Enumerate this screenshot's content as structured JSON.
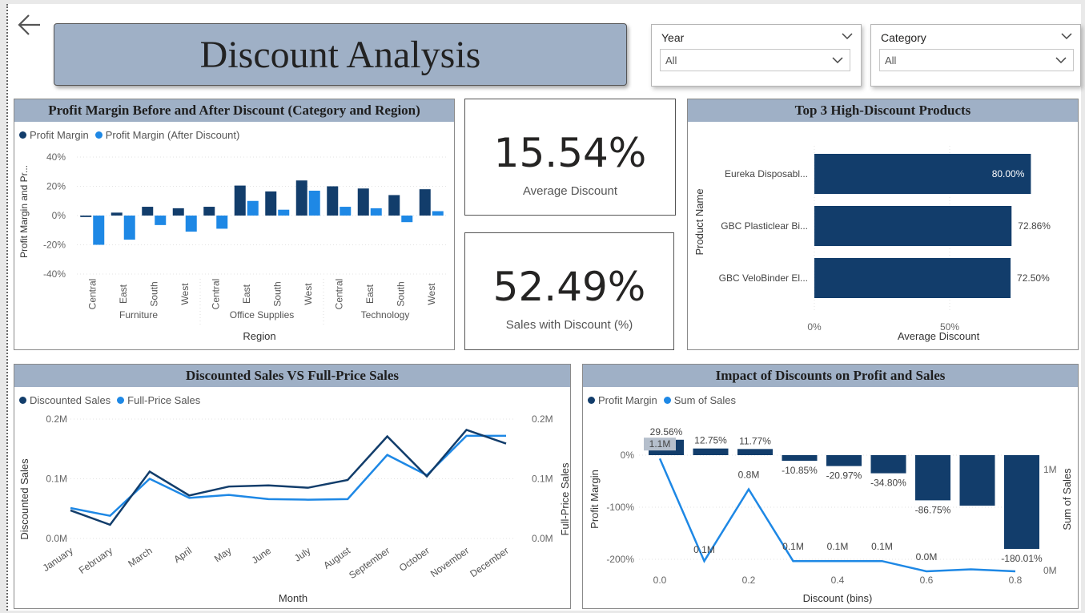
{
  "page_title": "Discount Analysis",
  "slicers": [
    {
      "label": "Year",
      "value": "All"
    },
    {
      "label": "Category",
      "value": "All"
    }
  ],
  "kpis": [
    {
      "value": "15.54%",
      "label": "Average Discount"
    },
    {
      "value": "52.49%",
      "label": "Sales with Discount (%)"
    }
  ],
  "colors": {
    "dark": "#123d6b",
    "light": "#1e88e5",
    "header": "#9fb0c6"
  },
  "chart_data": [
    {
      "id": "profit_margin",
      "type": "bar",
      "title": "Profit Margin Before and After Discount (Category and Region)",
      "xlabel": "Region",
      "ylabel": "Profit Margin and Pr...",
      "ylim": [
        -40,
        40
      ],
      "yticks": [
        "40%",
        "20%",
        "0%",
        "-20%",
        "-40%"
      ],
      "groups": [
        {
          "name": "Furniture",
          "categories": [
            "Central",
            "East",
            "South",
            "West"
          ]
        },
        {
          "name": "Office Supplies",
          "categories": [
            "Central",
            "East",
            "South",
            "West"
          ]
        },
        {
          "name": "Technology",
          "categories": [
            "Central",
            "East",
            "South",
            "West"
          ]
        }
      ],
      "series": [
        {
          "name": "Profit Margin",
          "values": [
            -1,
            2,
            6,
            5,
            6,
            20.5,
            16.5,
            24,
            20,
            18.5,
            14,
            18
          ]
        },
        {
          "name": "Profit Margin (After Discount)",
          "values": [
            -20,
            -16.5,
            -6.5,
            -11,
            -9,
            10,
            4,
            17,
            6,
            5,
            -4.5,
            3
          ]
        }
      ]
    },
    {
      "id": "top_products",
      "type": "bar",
      "title": "Top 3 High-Discount Products",
      "xlabel": "Average Discount",
      "ylabel": "Product Name",
      "xlim": [
        0,
        100
      ],
      "xticks": [
        "0%",
        "50%"
      ],
      "categories": [
        "Eureka Disposabl...",
        "GBC Plasticlear Bi...",
        "GBC VeloBinder El..."
      ],
      "values": [
        80.0,
        72.86,
        72.5
      ],
      "labels": [
        "80.00%",
        "72.86%",
        "72.50%"
      ]
    },
    {
      "id": "sales_lines",
      "type": "line",
      "title": "Discounted Sales VS Full-Price Sales",
      "xlabel": "Month",
      "ylabel": "Discounted Sales",
      "y2label": "Full-Price Sales",
      "ylim": [
        0,
        0.2
      ],
      "yticks": [
        "0.2M",
        "0.1M",
        "0.0M"
      ],
      "x": [
        "January",
        "February",
        "March",
        "April",
        "May",
        "June",
        "July",
        "August",
        "September",
        "October",
        "November",
        "December"
      ],
      "series": [
        {
          "name": "Discounted Sales",
          "values": [
            0.047,
            0.023,
            0.112,
            0.072,
            0.087,
            0.089,
            0.085,
            0.098,
            0.171,
            0.104,
            0.182,
            0.159
          ]
        },
        {
          "name": "Full-Price Sales",
          "values": [
            0.051,
            0.038,
            0.1,
            0.068,
            0.073,
            0.066,
            0.065,
            0.066,
            0.14,
            0.106,
            0.172,
            0.172
          ]
        }
      ]
    },
    {
      "id": "impact",
      "type": "bar",
      "title": "Impact of Discounts on Profit and Sales",
      "xlabel": "Discount (bins)",
      "ylabel": "Profit Margin",
      "y2label": "Sum of Sales",
      "ylim": [
        -200,
        30
      ],
      "yticks": [
        "0%",
        "-100%",
        "-200%"
      ],
      "y2ticks": [
        "1M",
        "0M"
      ],
      "xticks": [
        "0.0",
        "0.2",
        "0.4",
        "0.6",
        "0.8"
      ],
      "x": [
        0.0,
        0.1,
        0.2,
        0.3,
        0.4,
        0.5,
        0.6,
        0.7,
        0.8
      ],
      "series": [
        {
          "name": "Profit Margin",
          "values": [
            29.56,
            12.75,
            11.77,
            -10.85,
            -20.97,
            -34.8,
            -86.75,
            -97,
            -180.01
          ],
          "labels": [
            "29.56%",
            "12.75%",
            "11.77%",
            "-10.85%",
            "-20.97%",
            "-34.80%",
            "-86.75%",
            "",
            "-180.01%"
          ]
        },
        {
          "name": "Sum of Sales",
          "values": [
            1.1,
            0.1,
            0.8,
            0.1,
            0.1,
            0.1,
            0.0,
            0.02,
            0.0
          ],
          "labels": [
            "1.1M",
            "0.1M",
            "0.8M",
            "0.1M",
            "0.1M",
            "0.1M",
            "0.0M",
            "",
            ""
          ]
        }
      ]
    }
  ]
}
